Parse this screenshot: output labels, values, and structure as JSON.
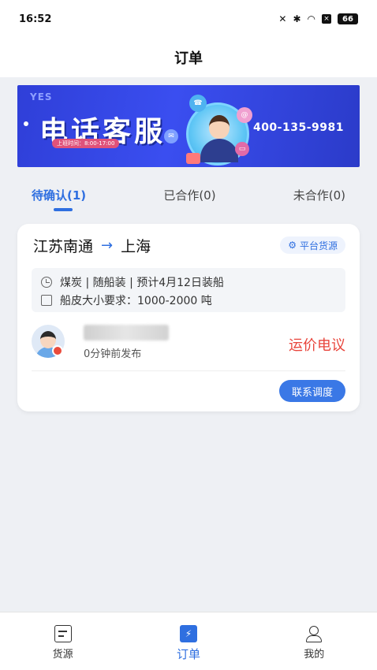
{
  "status_bar": {
    "time": "16:52",
    "battery": "66"
  },
  "header": {
    "title": "订单"
  },
  "banner": {
    "brand": "YES",
    "title": "电话客服",
    "hours": "上班时间：8:00-17:00",
    "phone": "400-135-9981"
  },
  "tabs": [
    {
      "label": "待确认(1)",
      "active": true
    },
    {
      "label": "已合作(0)",
      "active": false
    },
    {
      "label": "未合作(0)",
      "active": false
    }
  ],
  "order": {
    "origin": "江苏南通",
    "arrow": "→",
    "destination": "上海",
    "badge": "平台货源",
    "cargo_line": "煤炭 | 随船装 | 预计4月12日装船",
    "ship_size_line": "船皮大小要求：1000-2000 吨",
    "publish_time": "0分钟前发布",
    "price": "运价电议",
    "contact_button": "联系调度"
  },
  "bottom_nav": [
    {
      "label": "货源",
      "icon": "goods-icon",
      "active": false
    },
    {
      "label": "订单",
      "icon": "order-icon",
      "active": true
    },
    {
      "label": "我的",
      "icon": "profile-icon",
      "active": false
    }
  ],
  "colors": {
    "accent": "#2f6fe0",
    "price": "#e8453c",
    "background": "#eef0f4",
    "banner": "#3a4ef0"
  }
}
